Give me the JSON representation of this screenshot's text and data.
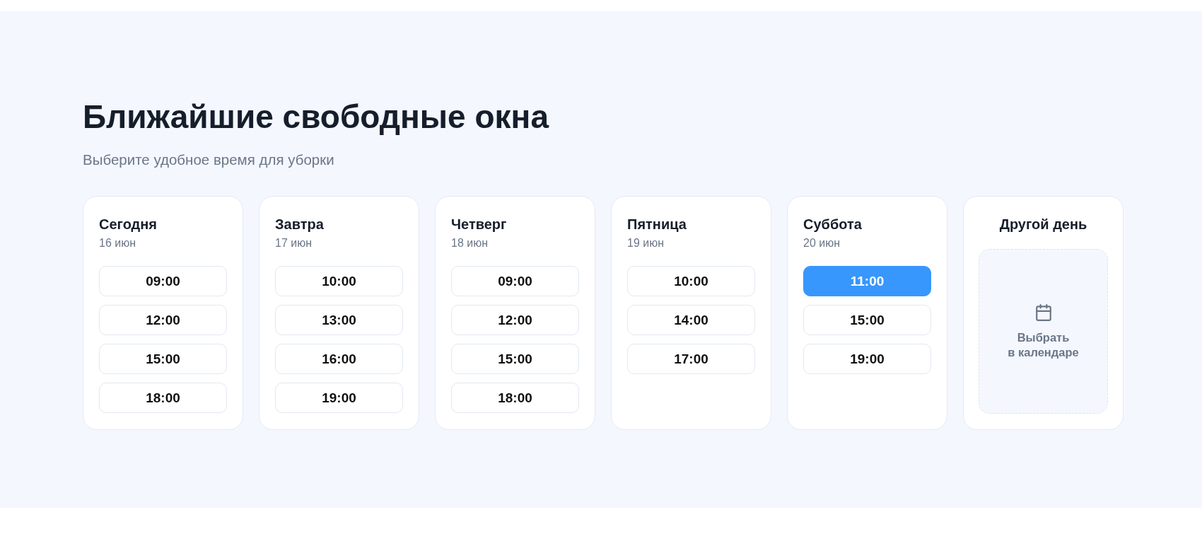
{
  "section": {
    "title": "Ближайшие свободные окна",
    "subtitle": "Выберите удобное время для уборки"
  },
  "days": [
    {
      "kind": "slots",
      "name": "Сегодня",
      "date": "16 июн",
      "slots": [
        {
          "time": "09:00",
          "selected": false
        },
        {
          "time": "12:00",
          "selected": false
        },
        {
          "time": "15:00",
          "selected": false
        },
        {
          "time": "18:00",
          "selected": false
        }
      ]
    },
    {
      "kind": "slots",
      "name": "Завтра",
      "date": "17 июн",
      "slots": [
        {
          "time": "10:00",
          "selected": false
        },
        {
          "time": "13:00",
          "selected": false
        },
        {
          "time": "16:00",
          "selected": false
        },
        {
          "time": "19:00",
          "selected": false
        }
      ]
    },
    {
      "kind": "slots",
      "name": "Четверг",
      "date": "18 июн",
      "slots": [
        {
          "time": "09:00",
          "selected": false
        },
        {
          "time": "12:00",
          "selected": false
        },
        {
          "time": "15:00",
          "selected": false
        },
        {
          "time": "18:00",
          "selected": false
        }
      ]
    },
    {
      "kind": "slots",
      "name": "Пятница",
      "date": "19 июн",
      "slots": [
        {
          "time": "10:00",
          "selected": false
        },
        {
          "time": "14:00",
          "selected": false
        },
        {
          "time": "17:00",
          "selected": false
        }
      ]
    },
    {
      "kind": "slots",
      "name": "Суббота",
      "date": "20 июн",
      "slots": [
        {
          "time": "11:00",
          "selected": true
        },
        {
          "time": "15:00",
          "selected": false
        },
        {
          "time": "19:00",
          "selected": false
        }
      ]
    },
    {
      "kind": "calendar",
      "name": "Другой день",
      "action": "Выбрать\nв календаре"
    }
  ]
}
